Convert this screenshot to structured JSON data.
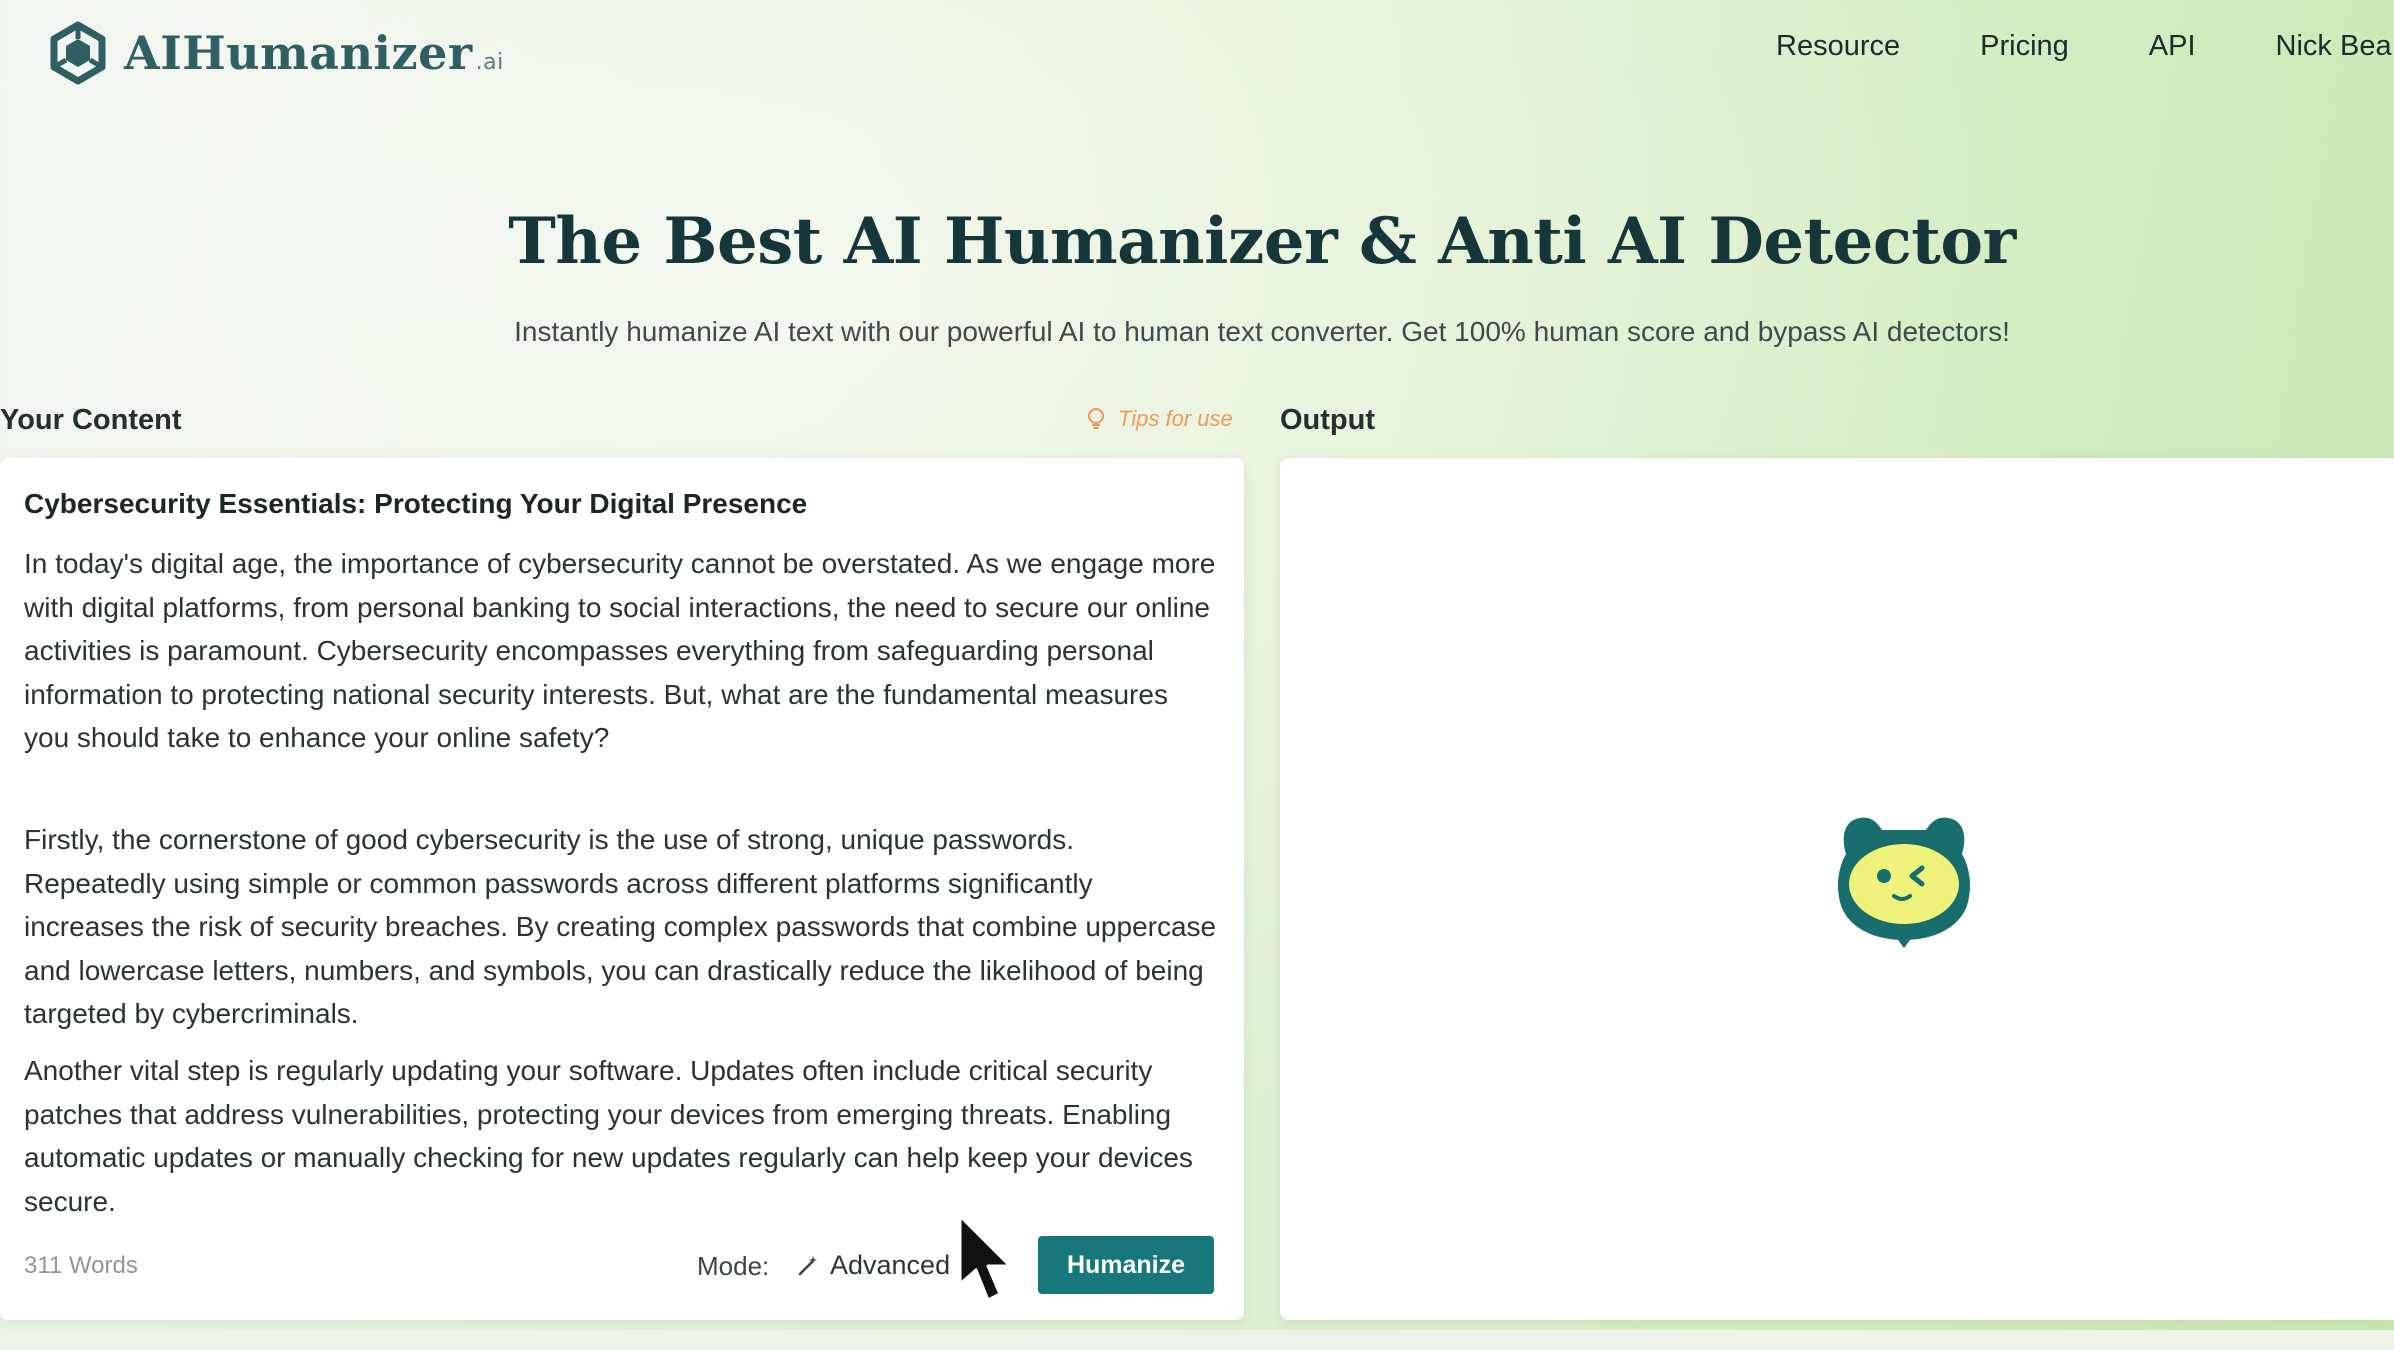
{
  "brand": {
    "name": "AIHumanizer",
    "suffix": ".ai"
  },
  "nav": {
    "items": [
      "Resource",
      "Pricing",
      "API"
    ],
    "account": "Nick Bea"
  },
  "hero": {
    "title": "The Best AI Humanizer & Anti AI Detector",
    "subtitle": "Instantly humanize AI text with our powerful AI to human text converter. Get 100% human score and bypass AI detectors!"
  },
  "input": {
    "label": "Your Content",
    "tips": "Tips for use",
    "doc_title": "Cybersecurity Essentials: Protecting Your Digital Presence",
    "paragraphs": [
      "In today's digital age, the importance of cybersecurity cannot be overstated. As we engage more with digital platforms, from personal banking to social interactions, the need to secure our online activities is paramount. Cybersecurity encompasses everything from safeguarding personal information to protecting national security interests. But, what are the fundamental measures you should take to enhance your online safety?",
      "Firstly, the cornerstone of good cybersecurity is the use of strong, unique passwords. Repeatedly using simple or common passwords across different platforms significantly increases the risk of security breaches. By creating complex passwords that combine uppercase and lowercase letters, numbers, and symbols, you can drastically reduce the likelihood of being targeted by cybercriminals.",
      "Another vital step is regularly updating your software. Updates often include critical security patches that address vulnerabilities, protecting your devices from emerging threats. Enabling automatic updates or manually checking for new updates regularly can help keep your devices secure."
    ],
    "word_count": "311 Words",
    "mode_label": "Mode:",
    "mode_value": "Advanced",
    "humanize_label": "Humanize"
  },
  "output": {
    "label": "Output"
  },
  "colors": {
    "accent": "#18777a",
    "brand_text": "#2f5e63",
    "tips": "#f09a5a",
    "mascot_body": "#176e6c",
    "mascot_face": "#eef27a"
  },
  "icons": {
    "logo": "hexagon-logo-icon",
    "tips": "lightbulb-icon",
    "mode": "magic-wand-icon",
    "mascot": "mascot-loading-icon",
    "cursor": "mouse-cursor-icon"
  }
}
